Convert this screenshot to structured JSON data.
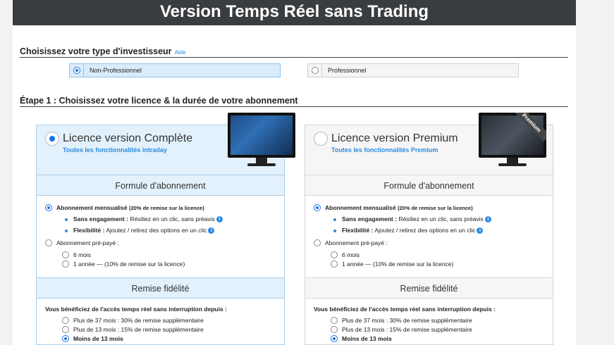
{
  "banner": {
    "title": "Version Temps Réel sans Trading"
  },
  "investor": {
    "heading": "Choisissez votre type d'investisseur",
    "help_link": "Aide",
    "options": [
      {
        "label": "Non-Professionnel",
        "selected": true
      },
      {
        "label": "Professionnel",
        "selected": false
      }
    ]
  },
  "step1": {
    "heading": "Étape 1 : Choisissez votre licence & la durée de votre abonnement"
  },
  "licenses": [
    {
      "title": "Licence version Complète",
      "subtitle": "Toutes les fonctionnalités intraday",
      "selected": true,
      "formula_heading": "Formule d'abonnement",
      "monthly_label": "Abonnement mensualisé",
      "monthly_note": "(20% de remise sur la licence)",
      "no_commitment_label": "Sans engagement :",
      "no_commitment_text": "Résiliez en un clic, sans préavis",
      "flex_label": "Flexibilité :",
      "flex_text": "Ajoutez / retirez des options en un clic",
      "prepaid_label": "Abonnement pré-payé :",
      "prepaid_6": "6 mois",
      "prepaid_year": "1 année — (10% de remise sur la licence)",
      "loyalty_heading": "Remise fidélité",
      "loyalty_intro": "Vous bénéficiez de l'accès temps réel sans interruption depuis :",
      "loyalty_37": "Plus de 37 mois : 30% de remise supplémentaire",
      "loyalty_13": "Plus de 13 mois : 15% de remise supplémentaire",
      "loyalty_less": "Moins de 13 mois"
    },
    {
      "title": "Licence version Premium",
      "subtitle": "Toutes les fonctionnalités Premium",
      "selected": false,
      "ribbon": "Premium",
      "formula_heading": "Formule d'abonnement",
      "monthly_label": "Abonnement mensualisé",
      "monthly_note": "(20% de remise sur la licence)",
      "no_commitment_label": "Sans engagement :",
      "no_commitment_text": "Résiliez en un clic, sans préavis",
      "flex_label": "Flexibilité :",
      "flex_text": "Ajoutez / retirez des options en un clic",
      "prepaid_label": "Abonnement pré-payé :",
      "prepaid_6": "6 mois",
      "prepaid_year": "1 année — (10% de remise sur la licence)",
      "loyalty_heading": "Remise fidélité",
      "loyalty_intro": "Vous bénéficiez de l'accès temps réel sans interruption depuis :",
      "loyalty_37": "Plus de 37 mois : 30% de remise supplémentaire",
      "loyalty_13": "Plus de 13 mois : 15% de remise supplémentaire",
      "loyalty_less": "Moins de 13 mois"
    }
  ],
  "colors": {
    "accent": "#1a73e8",
    "link": "#2b8be0",
    "banner_bg": "#3a3d40",
    "card_blue": "#e3f1fc"
  }
}
